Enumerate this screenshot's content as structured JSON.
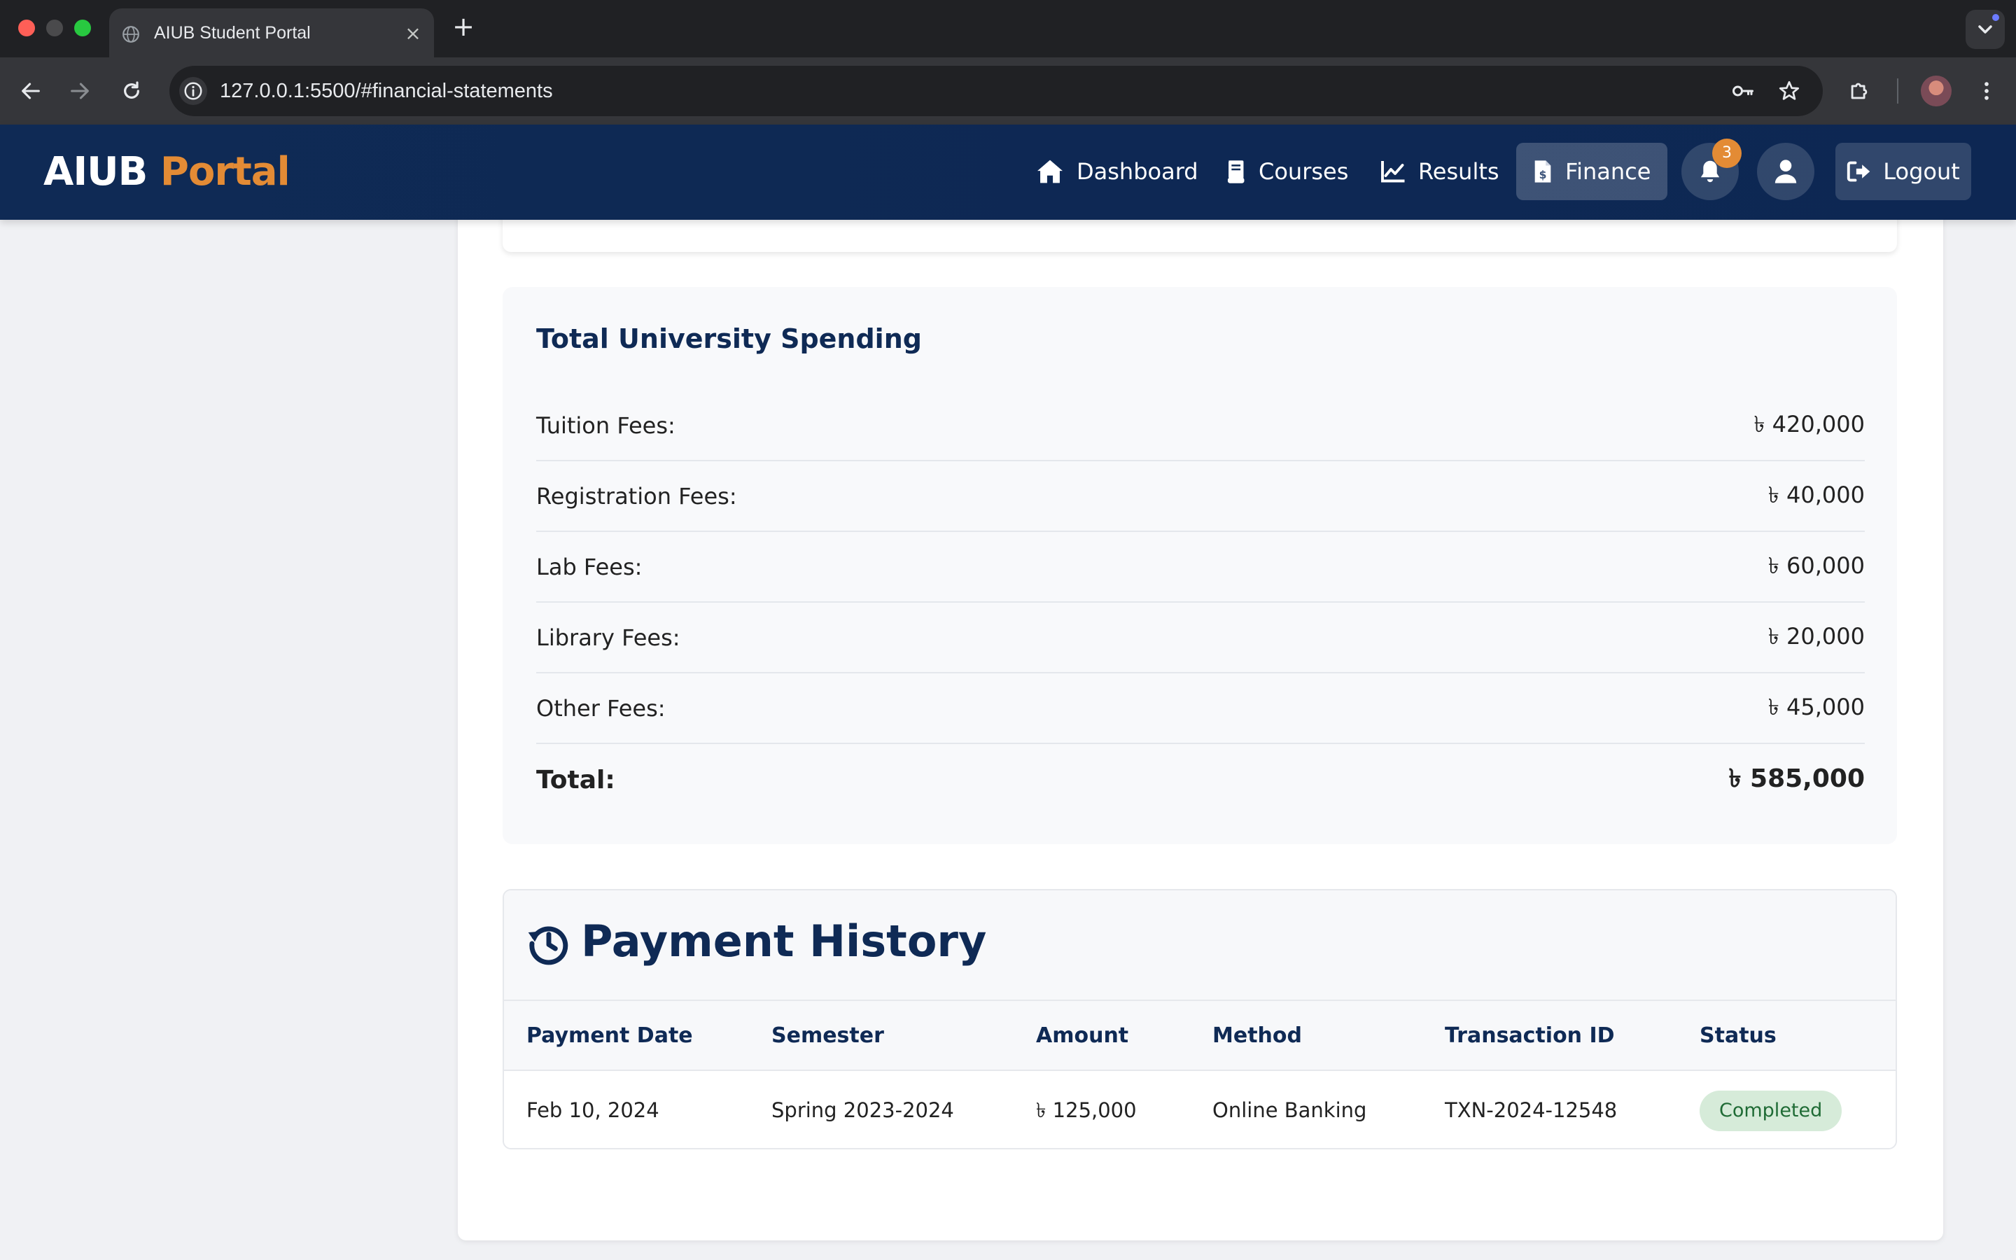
{
  "browser": {
    "tab_title": "AIUB Student Portal",
    "url": "127.0.0.1:5500/#financial-statements"
  },
  "header": {
    "logo_primary": "AIUB",
    "logo_secondary": "Portal",
    "nav": [
      {
        "label": "Dashboard",
        "icon": "home-icon"
      },
      {
        "label": "Courses",
        "icon": "book-icon"
      },
      {
        "label": "Results",
        "icon": "chart-line-icon"
      },
      {
        "label": "Finance",
        "icon": "file-invoice-dollar-icon",
        "active": true
      }
    ],
    "notification_count": "3",
    "logout_label": "Logout"
  },
  "spending": {
    "title": "Total University Spending",
    "rows": [
      {
        "label": "Tuition Fees:",
        "value": "৳ 420,000"
      },
      {
        "label": "Registration Fees:",
        "value": "৳ 40,000"
      },
      {
        "label": "Lab Fees:",
        "value": "৳ 60,000"
      },
      {
        "label": "Library Fees:",
        "value": "৳ 20,000"
      },
      {
        "label": "Other Fees:",
        "value": "৳ 45,000"
      }
    ],
    "total_label": "Total:",
    "total_value": "৳ 585,000"
  },
  "payment_history": {
    "title": "Payment History",
    "columns": [
      "Payment Date",
      "Semester",
      "Amount",
      "Method",
      "Transaction ID",
      "Status"
    ],
    "rows": [
      {
        "date": "Feb 10, 2024",
        "semester": "Spring 2023-2024",
        "amount": "৳ 125,000",
        "method": "Online Banking",
        "transaction_id": "TXN-2024-12548",
        "status": "Completed"
      }
    ]
  },
  "colors": {
    "navy": "#0f2a55",
    "accent_orange": "#e38b35",
    "status_completed_bg": "#d6ebd9",
    "status_completed_text": "#1f6b35"
  }
}
